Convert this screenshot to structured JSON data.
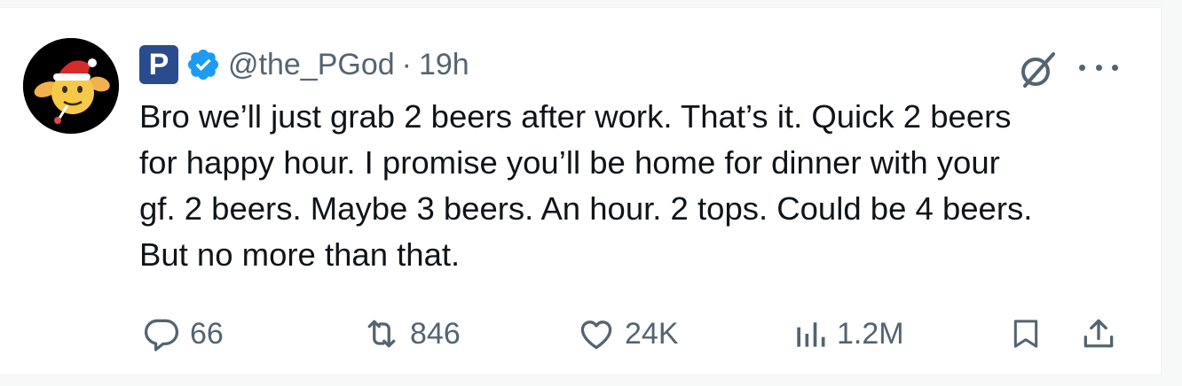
{
  "tweet": {
    "avatar_icon": "christmas-emoji-avatar",
    "badge_letter": "P",
    "handle": "@the_PGod",
    "separator": "·",
    "time": "19h",
    "text_lines": [
      "Bro we’ll just grab 2 beers after work. That’s it. Quick 2 beers",
      "for happy hour. I promise you’ll be home for dinner with your",
      "gf. 2 beers. Maybe 3 beers. An hour. 2 tops. Could be 4 beers.",
      "But no more than that."
    ],
    "stats": {
      "replies": "66",
      "reposts": "846",
      "likes": "24K",
      "views": "1.2M"
    }
  },
  "colors": {
    "text": "#0f1419",
    "muted": "#536471",
    "verified": "#1d9bf0",
    "badge": "#2a4b8d"
  },
  "icons": [
    "reply-icon",
    "repost-icon",
    "like-icon",
    "views-icon",
    "bookmark-icon",
    "share-icon",
    "grok-icon",
    "more-icon",
    "verified-icon"
  ]
}
